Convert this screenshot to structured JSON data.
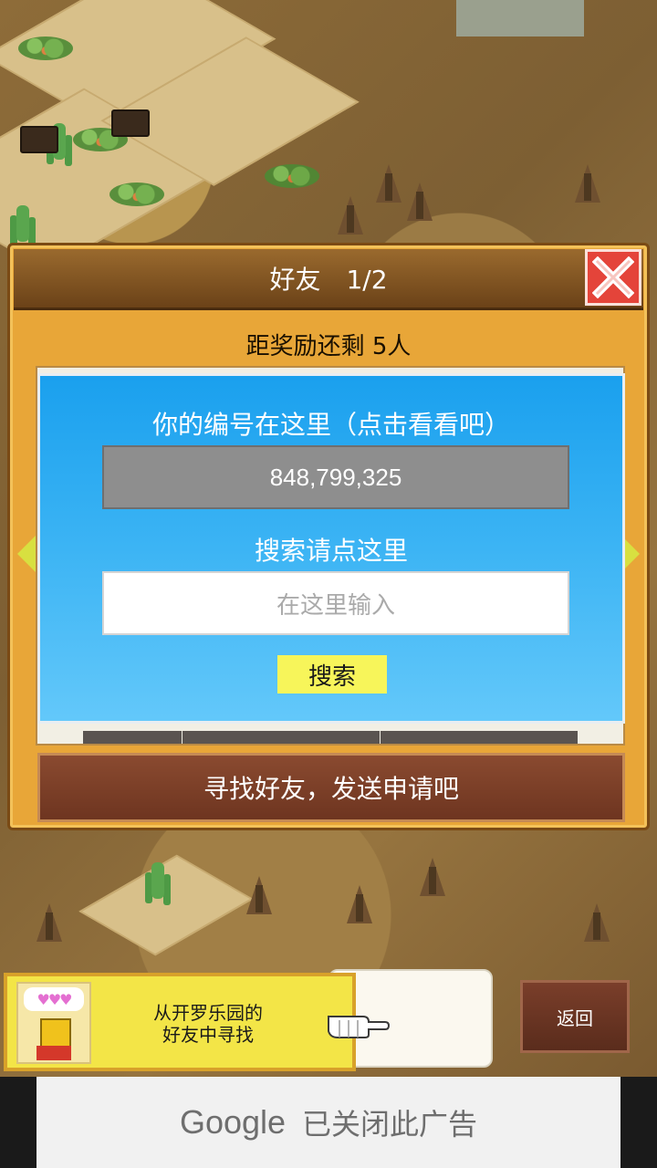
{
  "dialog": {
    "title": "好友　1/2",
    "reward_text": "距奖励还剩 5人",
    "id_label": "你的编号在这里（点击看看吧）",
    "id_value": "848,799,325",
    "search_label": "搜索请点这里",
    "search_placeholder": "在这里输入",
    "search_button": "搜索",
    "find_button": "寻找好友，发送申请吧"
  },
  "bottom": {
    "kairo_text_line1": "从开罗乐园的",
    "kairo_text_line2": "好友中寻找",
    "hearts": "♥♥♥",
    "back_button": "返回"
  },
  "ad": {
    "google": "Google",
    "closed_text": "已关闭此广告"
  },
  "colors": {
    "dialog_bg": "#e8a638",
    "blue_panel": "#3cb4f4",
    "search_button": "#f7f55a",
    "close_button": "#e4443a",
    "find_button": "#7a3e2a"
  }
}
